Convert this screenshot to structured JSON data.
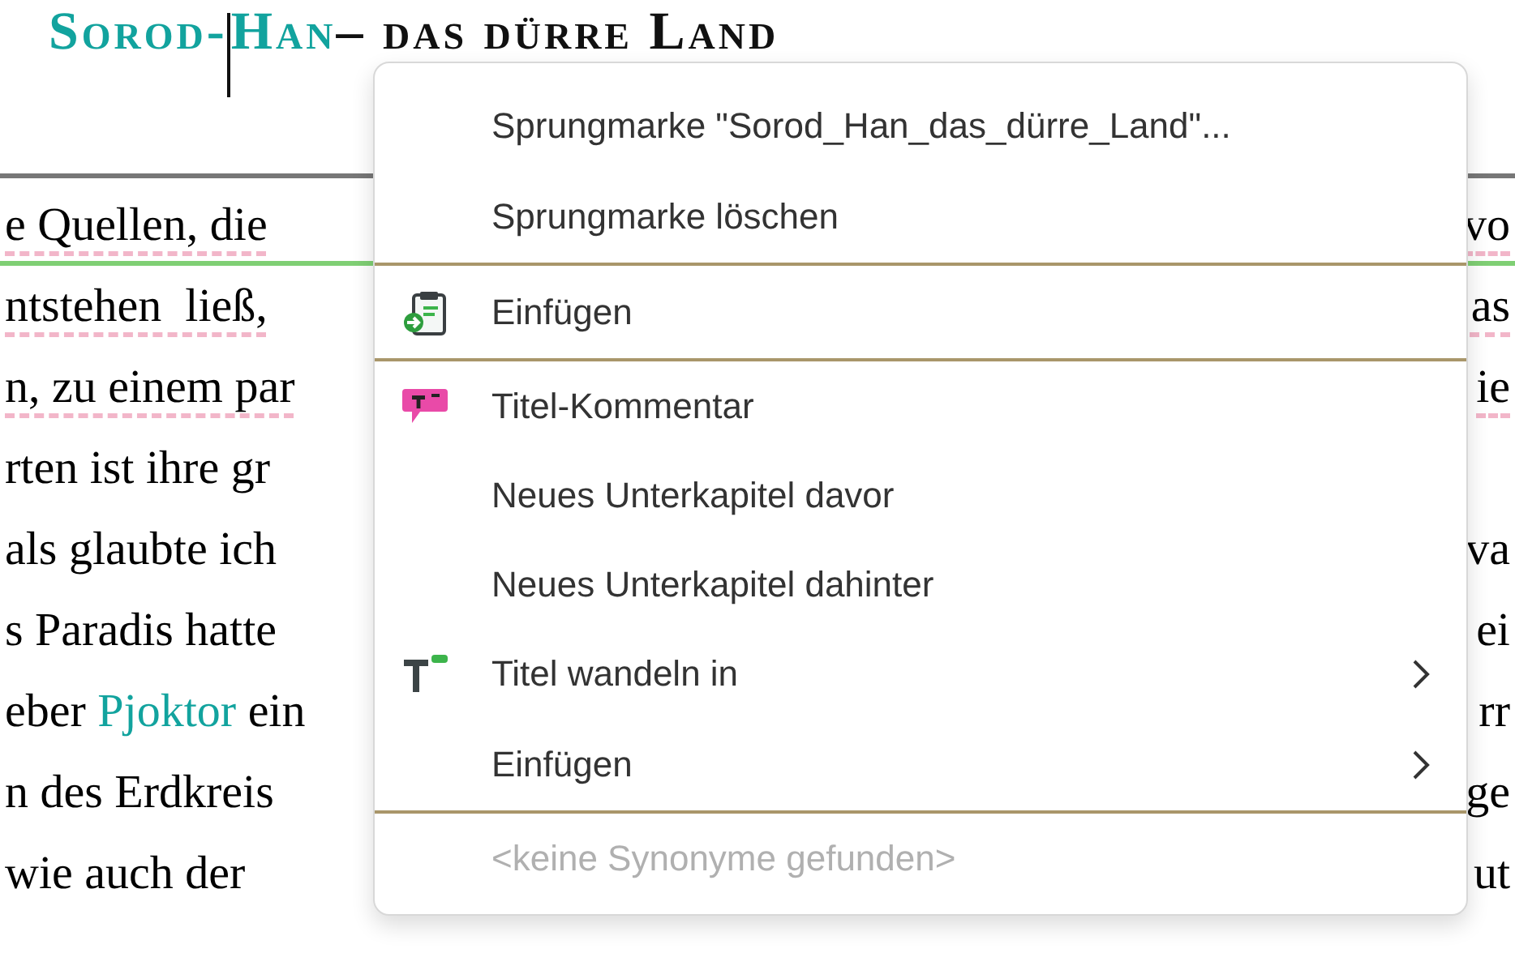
{
  "heading": {
    "parts": [
      {
        "text": "Sorod-",
        "accent": true,
        "caret": true
      },
      {
        "text": "Han",
        "accent": true,
        "caret": false
      },
      {
        "text": " – das dürre Land",
        "accent": false,
        "caret": false
      }
    ]
  },
  "lines": [
    {
      "left": [
        {
          "text": "e Quellen, die",
          "link": false
        }
      ],
      "right": "vo",
      "flagged": true,
      "highlighted": true
    },
    {
      "left": [
        {
          "text": "ntstehen  ließ,",
          "link": false
        }
      ],
      "right": "as",
      "flagged": true,
      "highlighted": false
    },
    {
      "left": [
        {
          "text": "n, zu einem par",
          "link": false
        }
      ],
      "right": "ie",
      "flagged": true,
      "highlighted": false
    },
    {
      "left": [
        {
          "text": "rten ist ihre gr",
          "link": false
        }
      ],
      "flagged": false,
      "highlighted": false
    },
    {
      "left": [
        {
          "text": "als glaubte ich",
          "link": false
        }
      ],
      "right": "va",
      "flagged": false,
      "highlighted": false
    },
    {
      "left": [
        {
          "text": "s Paradis hatte",
          "link": false
        }
      ],
      "right": "ei",
      "flagged": false,
      "highlighted": false
    },
    {
      "left": [
        {
          "text": "eber ",
          "link": false
        },
        {
          "text": "Pjoktor",
          "link": true
        },
        {
          "text": " ein",
          "link": false
        }
      ],
      "right": "rr",
      "flagged": false,
      "highlighted": false
    },
    {
      "left": [
        {
          "text": "n des Erdkreis",
          "link": false
        }
      ],
      "right": "ge",
      "flagged": false,
      "highlighted": false
    },
    {
      "left": [
        {
          "text": "wie auch der",
          "link": false
        }
      ],
      "right": "ut",
      "flagged": false,
      "highlighted": false
    }
  ],
  "context_menu": {
    "items": [
      {
        "label": "Sprungmarke \"Sorod_Han_das_dürre_Land\"...",
        "kind": "plain",
        "submenu": false,
        "disabled": false,
        "separator_after": false
      },
      {
        "label": "Sprungmarke löschen",
        "kind": "plain",
        "submenu": false,
        "disabled": false,
        "separator_after": true
      },
      {
        "label": "Einfügen",
        "kind": "paste",
        "submenu": false,
        "disabled": false,
        "separator_after": true
      },
      {
        "label": "Titel-Kommentar",
        "kind": "comment",
        "submenu": false,
        "disabled": false,
        "separator_after": false
      },
      {
        "label": "Neues Unterkapitel davor",
        "kind": "plain",
        "submenu": false,
        "disabled": false,
        "separator_after": false
      },
      {
        "label": "Neues Unterkapitel dahinter",
        "kind": "plain",
        "submenu": false,
        "disabled": false,
        "separator_after": false
      },
      {
        "label": "Titel wandeln in",
        "kind": "title",
        "submenu": true,
        "disabled": false,
        "separator_after": false
      },
      {
        "label": "Einfügen",
        "kind": "plain",
        "submenu": true,
        "disabled": false,
        "separator_after": true
      },
      {
        "label": "<keine Synonyme gefunden>",
        "kind": "plain",
        "submenu": false,
        "disabled": true,
        "separator_after": false
      }
    ]
  }
}
